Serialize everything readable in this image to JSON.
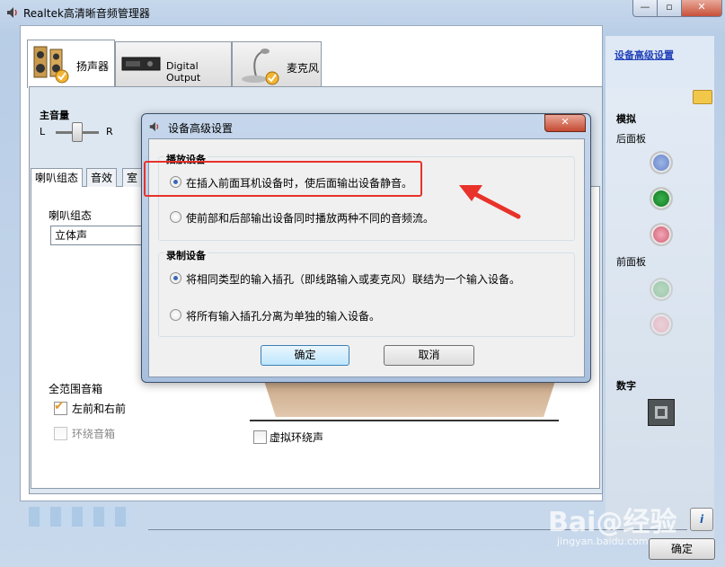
{
  "window": {
    "title": "Realtek高清晰音频管理器",
    "minimize_glyph": "—",
    "maximize_glyph": "▫",
    "close_glyph": "✕"
  },
  "tabs": [
    {
      "label": "扬声器"
    },
    {
      "label": "Digital Output"
    },
    {
      "label": "麦克风"
    }
  ],
  "volume": {
    "label": "主音量",
    "left": "L",
    "right": "R"
  },
  "subtabs": [
    {
      "label": "喇叭组态"
    },
    {
      "label": "音效"
    },
    {
      "label": "室"
    }
  ],
  "speaker_config": {
    "label": "喇叭组态",
    "selected": "立体声"
  },
  "fullrange": {
    "label": "全范围音箱",
    "items": [
      {
        "label": "左前和右前",
        "checked": true
      },
      {
        "label": "环绕音箱",
        "checked": false
      }
    ]
  },
  "virtual_surround": {
    "label": "虚拟环绕声",
    "checked": false
  },
  "right_panel": {
    "advanced_link": "设备高级设置",
    "analog": "模拟",
    "back_panel": "后面板",
    "front_panel": "前面板",
    "digital": "数字"
  },
  "footer": {
    "info_glyph": "i",
    "ok_label": "确定",
    "watermark": "Bai@经验",
    "watermark_sub": "jingyan.baidu.com"
  },
  "dialog": {
    "title": "设备高级设置",
    "close_glyph": "✕",
    "playback_group": "播放设备",
    "playback_options": [
      {
        "label": "在插入前面耳机设备时，使后面输出设备静音。",
        "selected": true
      },
      {
        "label": "使前部和后部输出设备同时播放两种不同的音频流。",
        "selected": false
      }
    ],
    "record_group": "录制设备",
    "record_options": [
      {
        "label": "将相同类型的输入插孔（即线路输入或麦克风）联结为一个输入设备。",
        "selected": true
      },
      {
        "label": "将所有输入插孔分离为单独的输入设备。",
        "selected": false
      }
    ],
    "ok_label": "确定",
    "cancel_label": "取消"
  },
  "colors": {
    "highlight": "#e8322a",
    "link": "#2545b9",
    "jack_blue": "#5b78c3",
    "jack_green": "#0a6b19",
    "jack_pink": "#cc4d65"
  }
}
